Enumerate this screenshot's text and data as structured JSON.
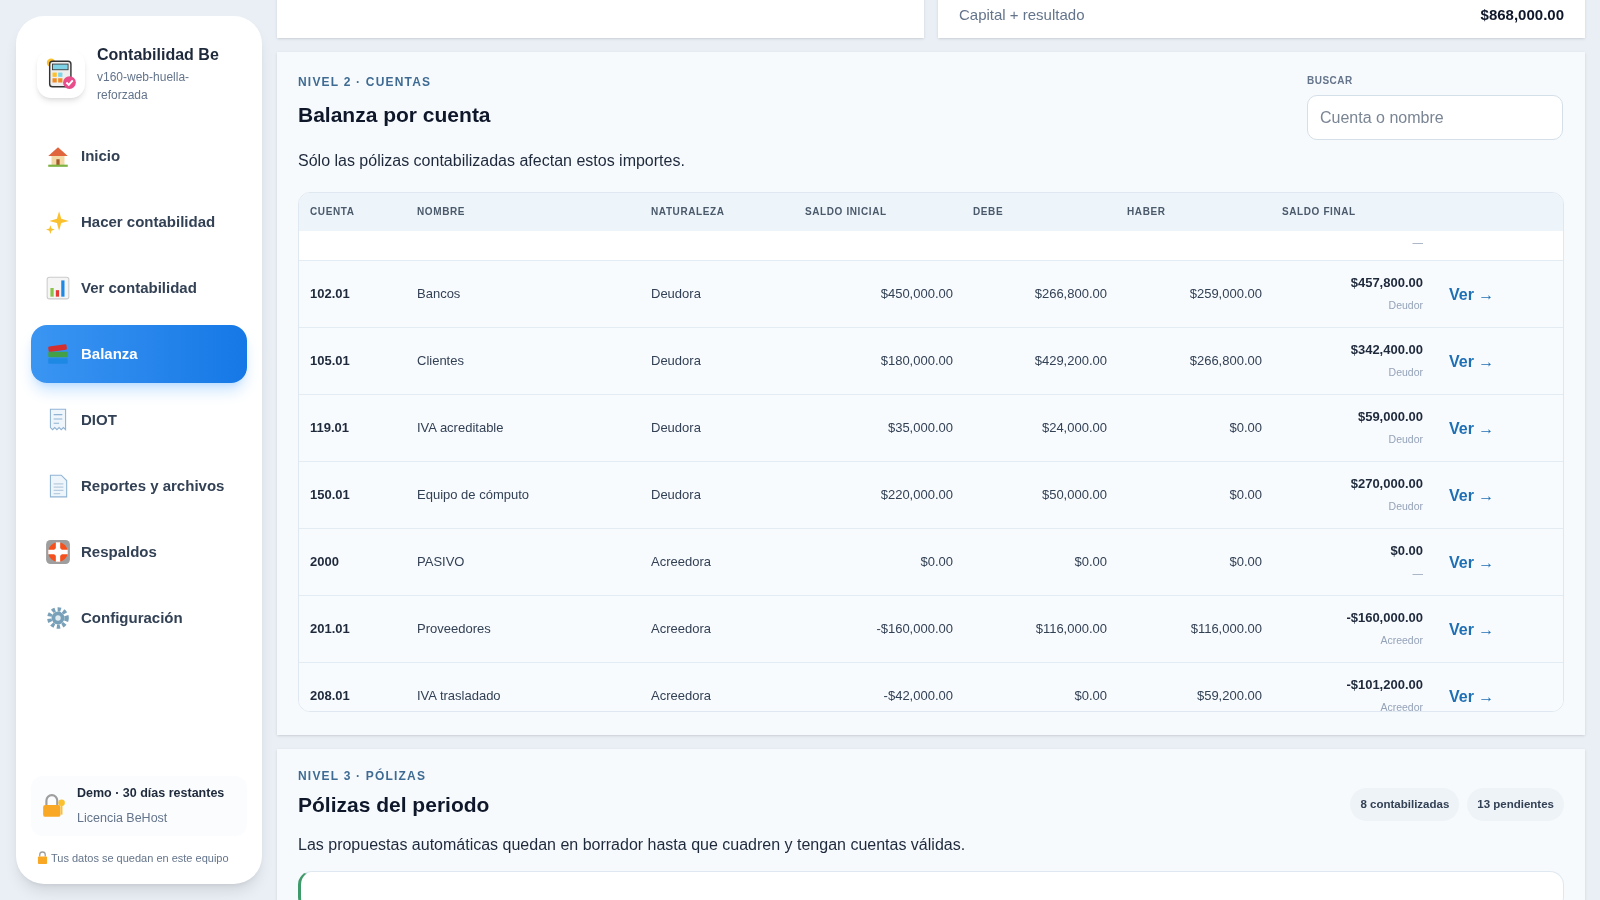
{
  "sidebar": {
    "app_name": "Contabilidad Be",
    "version": "v160-web-huella-reforzada",
    "items": [
      {
        "label": "Inicio",
        "selected": false
      },
      {
        "label": "Hacer contabilidad",
        "selected": false
      },
      {
        "label": "Ver contabilidad",
        "selected": false
      },
      {
        "label": "Balanza",
        "selected": true
      },
      {
        "label": "DIOT",
        "selected": false
      },
      {
        "label": "Reportes y archivos",
        "selected": false
      },
      {
        "label": "Respaldos",
        "selected": false
      },
      {
        "label": "Configuración",
        "selected": false
      }
    ],
    "license": {
      "title": "Demo · 30 días restantes",
      "subtitle": "Licencia BeHost"
    },
    "footer": "Tus datos se quedan en este equipo"
  },
  "summary_card": {
    "label": "Capital + resultado",
    "value": "$868,000.00"
  },
  "balanza": {
    "eyebrow": "NIVEL 2 · CUENTAS",
    "title": "Balanza por cuenta",
    "description": "Sólo las pólizas contabilizadas afectan estos importes.",
    "search": {
      "label": "BUSCAR",
      "placeholder": "Cuenta o nombre"
    },
    "columns": [
      "CUENTA",
      "NOMBRE",
      "NATURALEZA",
      "SALDO INICIAL",
      "DEBE",
      "HABER",
      "SALDO FINAL"
    ],
    "partial_row": {
      "saldo_nature": "—"
    },
    "rows": [
      {
        "cuenta": "102.01",
        "nombre": "Bancos",
        "naturaleza": "Deudora",
        "saldo_inicial": "$450,000.00",
        "debe": "$266,800.00",
        "haber": "$259,000.00",
        "saldo_final": "$457,800.00",
        "saldo_nature": "Deudor",
        "action": "Ver →"
      },
      {
        "cuenta": "105.01",
        "nombre": "Clientes",
        "naturaleza": "Deudora",
        "saldo_inicial": "$180,000.00",
        "debe": "$429,200.00",
        "haber": "$266,800.00",
        "saldo_final": "$342,400.00",
        "saldo_nature": "Deudor",
        "action": "Ver →"
      },
      {
        "cuenta": "119.01",
        "nombre": "IVA acreditable",
        "naturaleza": "Deudora",
        "saldo_inicial": "$35,000.00",
        "debe": "$24,000.00",
        "haber": "$0.00",
        "saldo_final": "$59,000.00",
        "saldo_nature": "Deudor",
        "action": "Ver →"
      },
      {
        "cuenta": "150.01",
        "nombre": "Equipo de cómputo",
        "naturaleza": "Deudora",
        "saldo_inicial": "$220,000.00",
        "debe": "$50,000.00",
        "haber": "$0.00",
        "saldo_final": "$270,000.00",
        "saldo_nature": "Deudor",
        "action": "Ver →"
      },
      {
        "cuenta": "2000",
        "nombre": "PASIVO",
        "naturaleza": "Acreedora",
        "saldo_inicial": "$0.00",
        "debe": "$0.00",
        "haber": "$0.00",
        "saldo_final": "$0.00",
        "saldo_nature": "—",
        "action": "Ver →"
      },
      {
        "cuenta": "201.01",
        "nombre": "Proveedores",
        "naturaleza": "Acreedora",
        "saldo_inicial": "-$160,000.00",
        "debe": "$116,000.00",
        "haber": "$116,000.00",
        "saldo_final": "-$160,000.00",
        "saldo_nature": "Acreedor",
        "action": "Ver →"
      },
      {
        "cuenta": "208.01",
        "nombre": "IVA trasladado",
        "naturaleza": "Acreedora",
        "saldo_inicial": "-$42,000.00",
        "debe": "$0.00",
        "haber": "$59,200.00",
        "saldo_final": "-$101,200.00",
        "saldo_nature": "Acreedor",
        "action": "Ver →"
      }
    ]
  },
  "polizas": {
    "eyebrow": "NIVEL 3 · PÓLIZAS",
    "title": "Pólizas del periodo",
    "badges": [
      "8 contabilizadas",
      "13 pendientes"
    ],
    "description": "Las propuestas automáticas quedan en borrador hasta que cuadren y tengan cuentas válidas."
  }
}
